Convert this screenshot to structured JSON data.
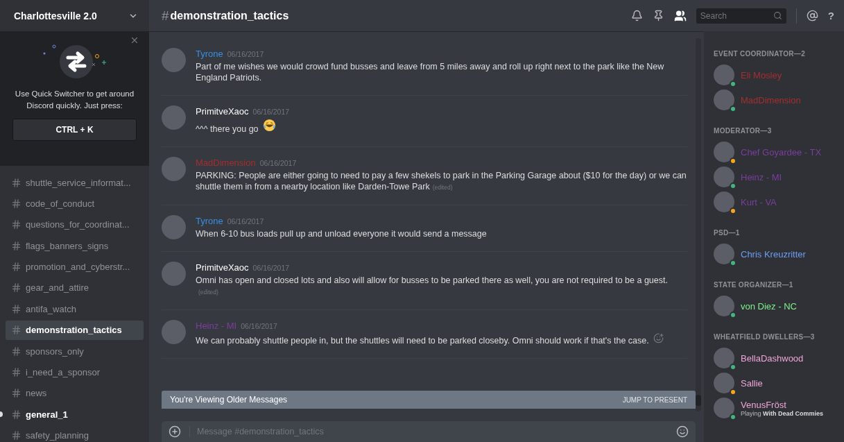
{
  "server": {
    "name": "Charlottesville 2.0"
  },
  "quick_switcher": {
    "text": "Use Quick Switcher to get around Discord quickly. Just press:",
    "shortcut": "CTRL + K"
  },
  "channels": [
    {
      "name": "shuttle_service_informat...",
      "selected": false,
      "unread": false
    },
    {
      "name": "code_of_conduct",
      "selected": false,
      "unread": false
    },
    {
      "name": "questions_for_coordinat...",
      "selected": false,
      "unread": false
    },
    {
      "name": "flags_banners_signs",
      "selected": false,
      "unread": false
    },
    {
      "name": "promotion_and_cyberstr...",
      "selected": false,
      "unread": false
    },
    {
      "name": "gear_and_attire",
      "selected": false,
      "unread": false
    },
    {
      "name": "antifa_watch",
      "selected": false,
      "unread": false
    },
    {
      "name": "demonstration_tactics",
      "selected": true,
      "unread": false
    },
    {
      "name": "sponsors_only",
      "selected": false,
      "unread": false
    },
    {
      "name": "i_need_a_sponsor",
      "selected": false,
      "unread": false
    },
    {
      "name": "news",
      "selected": false,
      "unread": false
    },
    {
      "name": "general_1",
      "selected": false,
      "unread": true
    },
    {
      "name": "safety_planning",
      "selected": false,
      "unread": false
    }
  ],
  "header": {
    "hash": "#",
    "channel": "demonstration_tactics",
    "search_placeholder": "Search",
    "help": "?"
  },
  "messages": [
    {
      "author": "Tyrone",
      "color": "#3b8fe0",
      "time": "06/16/2017",
      "text": "Part of me wishes we would crowd fund busses and leave from 5 miles away and roll up right next to the park like the New England Patriots."
    },
    {
      "author": "PrimitveXaoc",
      "color": "#ffffff",
      "time": "06/16/2017",
      "text": "^^^ there you go",
      "emoji": true
    },
    {
      "author": "MadDimension",
      "color": "#a42e2e",
      "time": "06/16/2017",
      "text": "PARKING: People are either going to need to pay a few shekels to park in the Parking Garage about ($10 for the day) or we can shuttle them in from a nearby location like Darden-Towe Park",
      "edited": "(edited)"
    },
    {
      "author": "Tyrone",
      "color": "#3b8fe0",
      "time": "06/16/2017",
      "text": "When 6-10 bus loads pull up and unload everyone it would send a message"
    },
    {
      "author": "PrimitveXaoc",
      "color": "#ffffff",
      "time": "06/16/2017",
      "text": "Omni has open and closed lots and also will allow for busses to be parked there as well, you are not required to be a guest.",
      "edited": "(edited)"
    },
    {
      "author": "Heinz - MI",
      "color": "#7a3e9d",
      "time": "06/16/2017",
      "text": "We can probably shuttle people in, but the shuttles will need to be parked closeby. Omni should work if that's the case.",
      "hovered": true
    }
  ],
  "older_banner": {
    "text": "You're Viewing Older Messages",
    "action": "JUMP TO PRESENT"
  },
  "composer": {
    "placeholder": "Message #demonstration_tactics"
  },
  "members": [
    {
      "role": "EVENT COORDINATOR—2",
      "people": [
        {
          "name": "Eli Mosley",
          "color": "#a42e2e",
          "idle": false
        },
        {
          "name": "MadDimension",
          "color": "#a42e2e",
          "idle": false
        }
      ]
    },
    {
      "role": "MODERATOR—3",
      "people": [
        {
          "name": "Chef Goyardee - TX",
          "color": "#7a3e9d",
          "idle": true
        },
        {
          "name": "Heinz - MI",
          "color": "#7a3e9d",
          "idle": false
        },
        {
          "name": "Kurt - VA",
          "color": "#7a3e9d",
          "idle": true
        }
      ]
    },
    {
      "role": "PSD—1",
      "people": [
        {
          "name": "Chris Kreuzritter",
          "color": "#6d9ef5",
          "idle": false
        }
      ]
    },
    {
      "role": "STATE ORGANIZER—1",
      "people": [
        {
          "name": "von Diez - NC",
          "color": "#7ef28a",
          "idle": false
        }
      ]
    },
    {
      "role": "WHEATFIELD DWELLERS—3",
      "people": [
        {
          "name": "BellaDashwood",
          "color": "#f0a6d8",
          "idle": false
        },
        {
          "name": "Sallie",
          "color": "#f0a6d8",
          "idle": true
        },
        {
          "name": "VenusFröst",
          "color": "#f0a6d8",
          "idle": false,
          "activity": "Playing **With Dead Commies**"
        }
      ]
    }
  ]
}
